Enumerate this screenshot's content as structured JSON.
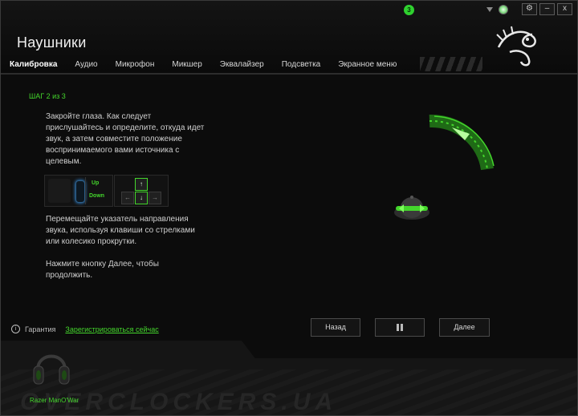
{
  "window": {
    "notification_count": "3",
    "controls": {
      "settings": "⚙",
      "minimize": "–",
      "close": "x"
    }
  },
  "header": {
    "title": "Наушники"
  },
  "tabs": [
    {
      "label": "Калибровка",
      "active": true
    },
    {
      "label": "Аудио"
    },
    {
      "label": "Микрофон"
    },
    {
      "label": "Микшер"
    },
    {
      "label": "Эквалайзер"
    },
    {
      "label": "Подсветка"
    },
    {
      "label": "Экранное меню"
    }
  ],
  "content": {
    "step": "ШАГ 2 из 3",
    "instruction_1": "Закройте глаза. Как следует прислушайтесь и определите, откуда идет звук, а затем совместите положение воспринимаемого вами источника с целевым.",
    "key_up": "Up",
    "key_down": "Down",
    "instruction_2": "Перемещайте указатель направления звука, используя клавиши со стрелками или колесико прокрутки.",
    "instruction_3": "Нажмите кнопку Далее, чтобы продолжить."
  },
  "bottom": {
    "warranty_label": "Гарантия",
    "register_link": "Зарегистрироваться сейчас",
    "back_button": "Назад",
    "next_button": "Далее"
  },
  "footer": {
    "device_name": "Razer ManO'War",
    "watermark": "OVERCLOCKERS.UA"
  },
  "colors": {
    "accent": "#44d62c",
    "background": "#0c0c0c"
  }
}
